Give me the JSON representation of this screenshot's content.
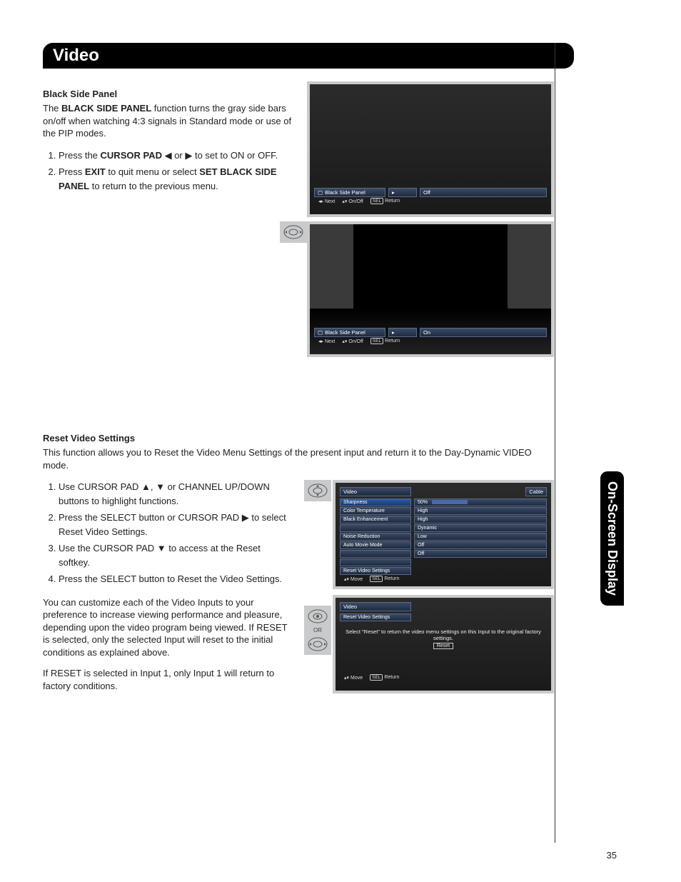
{
  "banner": "Video",
  "side_tab": "On-Screen Display",
  "page_number": "35",
  "bsp": {
    "heading": "Black Side Panel",
    "intro_pre": "The ",
    "intro_bold": "BLACK SIDE PANEL",
    "intro_post": " function turns the gray side bars on/off when watching 4:3 signals in Standard mode or use of the PIP modes.",
    "step1_pre": "Press the ",
    "step1_bold": "CURSOR PAD",
    "step1_post": " ◀ or ▶ to set to ON or OFF.",
    "step2_pre": "Press ",
    "step2_bold1": "EXIT",
    "step2_mid": " to quit menu or select ",
    "step2_bold2": "SET BLACK SIDE PANEL",
    "step2_post": " to return to the previous menu."
  },
  "osd1": {
    "label": "Black Side Panel",
    "value": "Off",
    "hint_next": "Next",
    "hint_onoff": "On/Off",
    "hint_sel": "SEL",
    "hint_return": "Return"
  },
  "osd2": {
    "label": "Black Side Panel",
    "value": "On",
    "hint_next": "Next",
    "hint_onoff": "On/Off",
    "hint_sel": "SEL",
    "hint_return": "Return"
  },
  "reset": {
    "heading": "Reset Video Settings",
    "intro": "This function allows you to Reset the Video Menu Settings of the present input and return it to the Day-Dynamic VIDEO mode.",
    "step1": "Use CURSOR PAD ▲, ▼ or CHANNEL UP/DOWN buttons to highlight functions.",
    "step2": "Press the SELECT button or CURSOR PAD ▶ to select Reset Video Settings.",
    "step3": "Use the CURSOR PAD ▼ to access at the Reset softkey.",
    "step4": "Press the SELECT button to Reset the Video Settings.",
    "para1": "You can customize each of the Video Inputs to your preference to increase viewing performance and pleasure, depending upon the video program being viewed. If RESET is selected, only the selected Input will reset to the initial conditions as explained above.",
    "para2": "If RESET is selected in Input 1, only Input 1 will return to factory conditions."
  },
  "video_menu": {
    "title": "Video",
    "cable": "Cable",
    "rows": [
      {
        "label": "Sharpness",
        "value": "50%"
      },
      {
        "label": "Color Temperature",
        "value": "High"
      },
      {
        "label": "Black Enhancement",
        "value": "High"
      },
      {
        "label": "",
        "value": "Dynamic"
      },
      {
        "label": "Noise Reduction",
        "value": "Low"
      },
      {
        "label": "Auto Movie Mode",
        "value": "Off"
      },
      {
        "label": "",
        "value": "Off"
      },
      {
        "label": "",
        "value": ""
      },
      {
        "label": "Reset Video Settings",
        "value": ""
      }
    ],
    "hint_move": "Move",
    "hint_sel": "SEL",
    "hint_return": "Return"
  },
  "reset_menu": {
    "title": "Video",
    "subtitle": "Reset Video Settings",
    "text": "Select \"Reset\" to return the video menu settings on this Input to the original factory settings.",
    "button": "Reset",
    "hint_move": "Move",
    "hint_sel": "SEL",
    "hint_return": "Return",
    "or": "OR"
  }
}
